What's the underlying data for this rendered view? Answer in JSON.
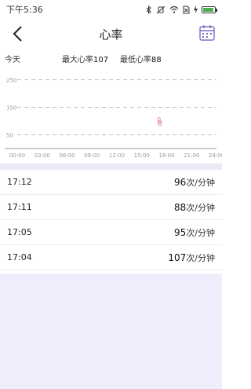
{
  "status_bar": {
    "time": "下午5:36",
    "battery_level": 0.95
  },
  "header": {
    "title": "心率",
    "back_icon": "back-chevron-icon",
    "calendar_icon": "calendar-icon"
  },
  "summary": {
    "today_label": "今天",
    "max_label": "最大心率",
    "max_value": "107",
    "min_label": "最低心率",
    "min_value": "88"
  },
  "chart_data": {
    "type": "scatter",
    "x_ticks": [
      "00:00",
      "03:00",
      "06:00",
      "09:00",
      "12:00",
      "15:00",
      "18:00",
      "21:00",
      "24:00"
    ],
    "y_ticks": [
      "250",
      "150",
      "50"
    ],
    "ylim": [
      0,
      300
    ],
    "gridlines": [
      250,
      150,
      50
    ],
    "points": [
      {
        "x": "17:04",
        "y": 107
      },
      {
        "x": "17:05",
        "y": 95
      },
      {
        "x": "17:11",
        "y": 88
      },
      {
        "x": "17:12",
        "y": 96
      }
    ],
    "point_color": "#e89aa6",
    "grid_color": "#bbbbbb"
  },
  "records": [
    {
      "time": "17:12",
      "value": "96",
      "unit": "次/分钟"
    },
    {
      "time": "17:11",
      "value": "88",
      "unit": "次/分钟"
    },
    {
      "time": "17:05",
      "value": "95",
      "unit": "次/分钟"
    },
    {
      "time": "17:04",
      "value": "107",
      "unit": "次/分钟"
    }
  ],
  "colors": {
    "accent_bg": "#efedfb",
    "band": "#ece9f7"
  }
}
